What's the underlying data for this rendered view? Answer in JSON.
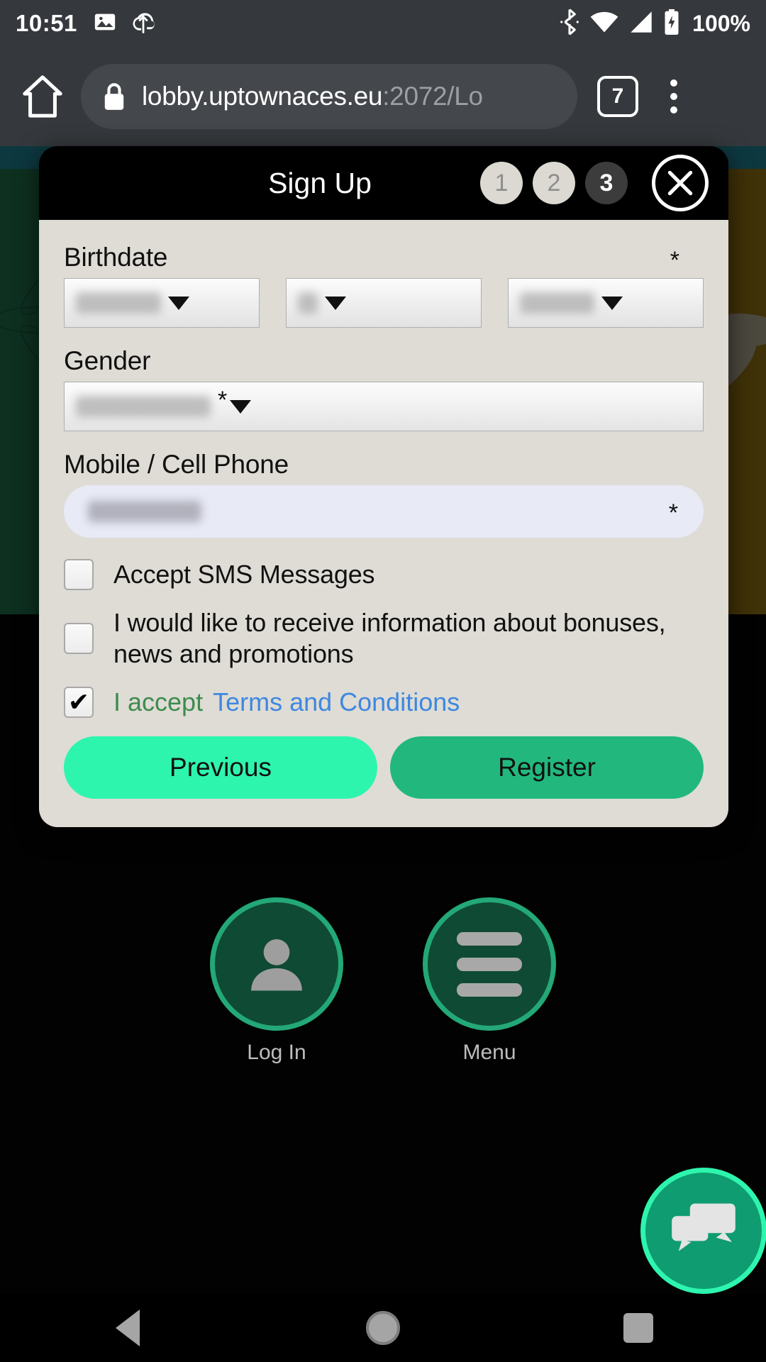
{
  "status_bar": {
    "time": "10:51",
    "battery_percent": "100%",
    "icons": [
      "image-icon",
      "cloud-upload-icon",
      "bluetooth-icon",
      "wifi-icon",
      "cellular-signal-icon",
      "battery-charging-icon"
    ]
  },
  "browser": {
    "url_host": "lobby.uptownaces.eu",
    "url_path": ":2072/Lo",
    "tab_count": "7",
    "home_icon": "home-icon",
    "lock_icon": "lock-icon",
    "menu_icon": "kebab-menu-icon"
  },
  "modal": {
    "title": "Sign Up",
    "steps": [
      {
        "label": "1",
        "state": "done"
      },
      {
        "label": "2",
        "state": "done"
      },
      {
        "label": "3",
        "state": "active"
      }
    ],
    "close_icon": "close-icon",
    "fields": {
      "birthdate": {
        "label": "Birthdate",
        "required_mark": "*",
        "selects": [
          {
            "name": "birth-day-select",
            "value": "",
            "redacted": true
          },
          {
            "name": "birth-month-select",
            "value": "",
            "redacted": true
          },
          {
            "name": "birth-year-select",
            "value": "",
            "redacted": true
          }
        ]
      },
      "gender": {
        "label": "Gender",
        "required_mark": "*",
        "value": "",
        "redacted": true
      },
      "phone": {
        "label": "Mobile / Cell Phone",
        "required_mark": "*",
        "value": "",
        "redacted": true
      }
    },
    "checkboxes": [
      {
        "name": "accept-sms-checkbox",
        "label": "Accept SMS Messages",
        "checked": false
      },
      {
        "name": "marketing-optin-checkbox",
        "label": "I would like to receive information about bonuses, news and promotions",
        "checked": false
      }
    ],
    "terms": {
      "checkbox_name": "accept-terms-checkbox",
      "checked": true,
      "accept_text": "I accept",
      "link_text": "Terms and Conditions"
    },
    "buttons": {
      "previous": "Previous",
      "register": "Register"
    }
  },
  "bottom_actions": [
    {
      "name": "login-action",
      "label": "Log In",
      "icon": "person-icon"
    },
    {
      "name": "menu-action",
      "label": "Menu",
      "icon": "hamburger-icon"
    }
  ],
  "chat_fab": {
    "name": "chat-fab",
    "icon": "chat-bubbles-icon"
  },
  "android_nav": [
    {
      "name": "nav-back-button",
      "icon": "triangle-back-icon"
    },
    {
      "name": "nav-home-button",
      "icon": "circle-home-icon"
    },
    {
      "name": "nav-recents-button",
      "icon": "square-recents-icon"
    }
  ],
  "colors": {
    "accent_mint": "#2EF5AE",
    "accent_green": "#22B87D",
    "dark_green": "#0F4A34",
    "modal_body": "#DEDCD5",
    "link_blue": "#3E87E0",
    "accept_green": "#3E8B4E",
    "chrome_gray": "#35383C"
  }
}
